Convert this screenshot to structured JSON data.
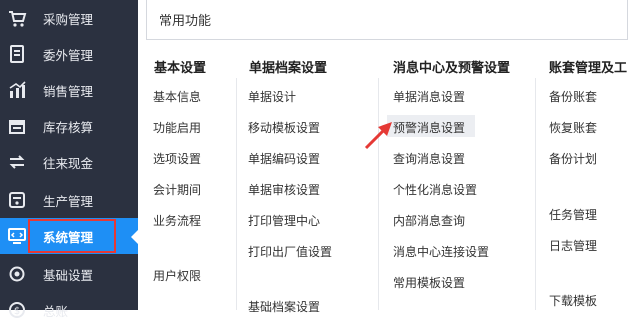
{
  "sidebar": {
    "items": [
      {
        "label": "采购管理",
        "icon": "cart-icon"
      },
      {
        "label": "委外管理",
        "icon": "document-icon"
      },
      {
        "label": "销售管理",
        "icon": "chart-icon"
      },
      {
        "label": "库存核算",
        "icon": "warehouse-icon"
      },
      {
        "label": "往来现金",
        "icon": "exchange-icon"
      },
      {
        "label": "生产管理",
        "icon": "production-icon"
      },
      {
        "label": "系统管理",
        "icon": "system-icon",
        "active": true
      },
      {
        "label": "基础设置",
        "icon": "settings-icon"
      },
      {
        "label": "总账",
        "icon": "ledger-icon"
      }
    ]
  },
  "header": {
    "title": "常用功能"
  },
  "columns": [
    {
      "title": "基本设置",
      "items": [
        "基本信息",
        "功能启用",
        "选项设置",
        "会计期间",
        "业务流程",
        "用户权限"
      ]
    },
    {
      "title": "单据档案设置",
      "items": [
        "单据设计",
        "移动模板设置",
        "单据编码设置",
        "单据审核设置",
        "打印管理中心",
        "打印出厂值设置",
        "基础档案设置"
      ]
    },
    {
      "title": "消息中心及预警设置",
      "items": [
        "单据消息设置",
        "预警消息设置",
        "查询消息设置",
        "个性化消息设置",
        "内部消息查询",
        "消息中心连接设置",
        "常用模板设置"
      ]
    },
    {
      "title": "账套管理及工",
      "items": [
        "备份账套",
        "恢复账套",
        "备份计划",
        "任务管理",
        "日志管理",
        "下载模板"
      ]
    }
  ],
  "colors": {
    "sidebar_bg": "#2b3140",
    "active_bg": "#1e8ff5",
    "highlight_border": "#e53935",
    "arrow": "#e53935"
  }
}
